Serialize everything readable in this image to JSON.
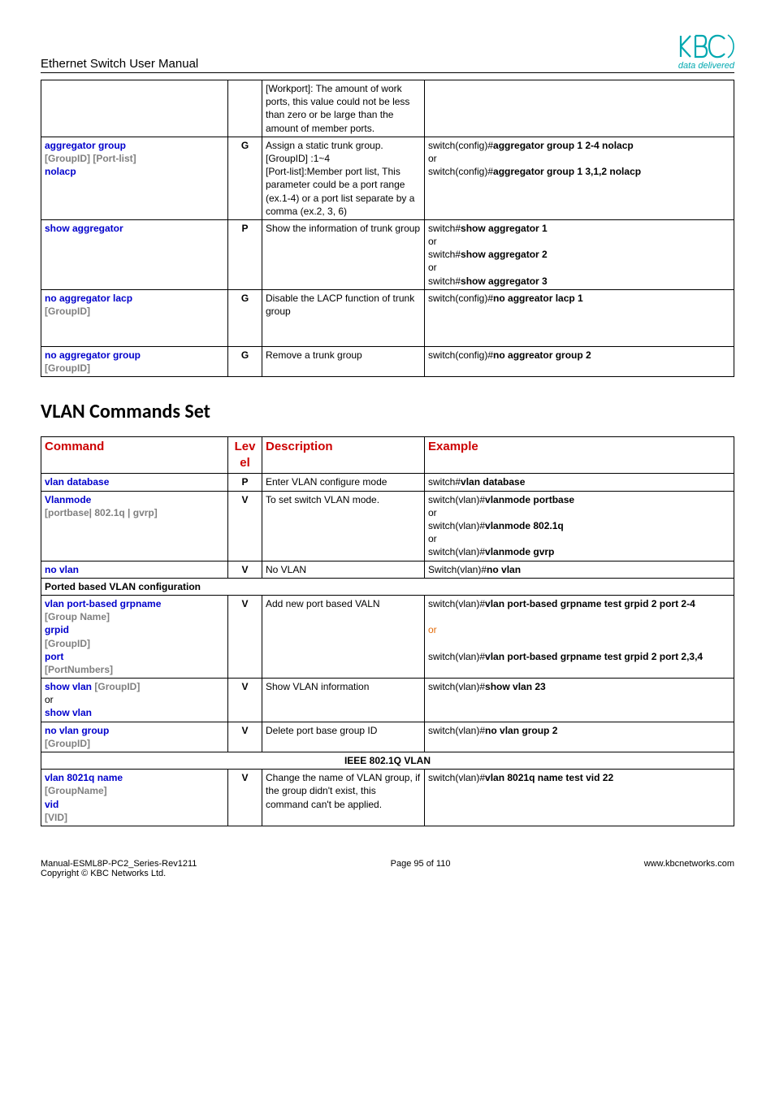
{
  "header": {
    "title": "Ethernet Switch User Manual",
    "logo_tag": "data delivered"
  },
  "table1": {
    "rows": [
      {
        "cmd_parts": [],
        "level": "",
        "desc": "[Workport]: The amount of work ports, this value could not be less than zero or be large than the amount of member ports.",
        "example_parts": []
      },
      {
        "cmd_parts": [
          {
            "text": "aggregator group",
            "cls": "blue bold"
          },
          {
            "text": "[GroupID] [Port-list]",
            "cls": "gray bold"
          },
          {
            "text": "nolacp",
            "cls": "blue bold"
          }
        ],
        "level": "G",
        "desc": "Assign a static trunk group.\n[GroupID] :1~4\n[Port-list]:Member port list, This parameter could be a port range (ex.1-4) or a port list separate by a comma (ex.2, 3, 6)",
        "example_parts": [
          {
            "pre": "switch(config)#",
            "bold": "aggregator group 1 2-4 nolacp"
          },
          {
            "pre": "or",
            "bold": ""
          },
          {
            "pre": "switch(config)#",
            "bold": "aggregator group 1 3,1,2 nolacp"
          }
        ]
      },
      {
        "cmd_parts": [
          {
            "text": "show aggregator",
            "cls": "blue bold"
          }
        ],
        "level": "P",
        "desc": "Show the information of trunk group",
        "example_parts": [
          {
            "pre": "switch#",
            "bold": "show aggregator 1"
          },
          {
            "pre": "or",
            "bold": ""
          },
          {
            "pre": "switch#",
            "bold": "show aggregator 2"
          },
          {
            "pre": "or",
            "bold": ""
          },
          {
            "pre": "switch#",
            "bold": "show aggregator 3"
          }
        ]
      },
      {
        "cmd_parts": [
          {
            "text": "no aggregator lacp",
            "cls": "blue bold"
          },
          {
            "text": "[GroupID]",
            "cls": "gray bold"
          }
        ],
        "level": "G",
        "desc": "Disable the LACP function of trunk group",
        "example_parts": [
          {
            "pre": "switch(config)#",
            "bold": "no aggreator lacp 1"
          }
        ],
        "min_lines": 4
      },
      {
        "cmd_parts": [
          {
            "text": "no aggregator group",
            "cls": "blue bold"
          },
          {
            "text": "[GroupID]",
            "cls": "gray bold"
          }
        ],
        "level": "G",
        "desc": "Remove a trunk group",
        "example_parts": [
          {
            "pre": "switch(config)#",
            "bold": "no aggreator group 2"
          }
        ],
        "min_lines": 2
      }
    ]
  },
  "section_heading": "VLAN Commands Set",
  "table2": {
    "headers": {
      "cmd": "Command",
      "lvl": "Level",
      "desc": "Description",
      "ex": "Example"
    },
    "rows": [
      {
        "type": "row",
        "cmd_parts": [
          {
            "text": "vlan database",
            "cls": "blue bold"
          }
        ],
        "level": "P",
        "desc": "Enter VLAN configure mode",
        "example_parts": [
          {
            "pre": "switch#",
            "bold": "vlan database"
          }
        ]
      },
      {
        "type": "row",
        "cmd_parts": [
          {
            "text": "Vlanmode",
            "cls": "blue bold"
          },
          {
            "text": "[portbase| 802.1q | gvrp]",
            "cls": "gray bold"
          }
        ],
        "level": "V",
        "desc": "To set switch VLAN mode.",
        "example_parts": [
          {
            "pre": "switch(vlan)#",
            "bold": "vlanmode portbase"
          },
          {
            "pre": "or",
            "bold": ""
          },
          {
            "pre": "switch(vlan)#",
            "bold": "vlanmode 802.1q"
          },
          {
            "pre": "or",
            "bold": ""
          },
          {
            "pre": "switch(vlan)#",
            "bold": "vlanmode gvrp"
          }
        ]
      },
      {
        "type": "row",
        "cmd_parts": [
          {
            "text": "no vlan",
            "cls": "blue bold"
          }
        ],
        "level": "V",
        "desc": "No VLAN",
        "example_parts": [
          {
            "pre": "Switch(vlan)#",
            "bold": "no vlan"
          }
        ]
      },
      {
        "type": "subheader",
        "text": "Ported based VLAN configuration",
        "align": "left"
      },
      {
        "type": "row",
        "cmd_parts": [
          {
            "text": "vlan port-based grpname",
            "cls": "blue bold"
          },
          {
            "text": "[Group Name]",
            "cls": "gray bold"
          },
          {
            "text": "grpid",
            "cls": "blue bold"
          },
          {
            "text": "[GroupID]",
            "cls": "gray bold"
          },
          {
            "text": "port",
            "cls": "blue bold"
          },
          {
            "text": "[PortNumbers]",
            "cls": "gray bold"
          }
        ],
        "level": "V",
        "desc": "Add new port based VALN",
        "example_parts": [
          {
            "pre": "switch(vlan)#",
            "bold": "vlan port-based grpname test grpid 2 port 2-4"
          },
          {
            "pre_cls": "orange",
            "pre": "or",
            "bold": ""
          },
          {
            "pre": "switch(vlan)#",
            "bold": "vlan port-based grpname test grpid 2 port 2,3,4"
          }
        ],
        "ex_spaced": true
      },
      {
        "type": "row",
        "cmd_parts": [
          {
            "text": "show vlan ",
            "cls": "blue bold",
            "inline_next": true
          },
          {
            "text": "[GroupID]",
            "cls": "gray bold",
            "inline": true
          },
          {
            "text": "or",
            "cls": ""
          },
          {
            "text": "show vlan",
            "cls": "blue bold"
          }
        ],
        "level": "V",
        "desc": "Show VLAN information",
        "example_parts": [
          {
            "pre": "switch(vlan)#",
            "bold": "show vlan 23"
          }
        ],
        "min_lines": 3
      },
      {
        "type": "row",
        "cmd_parts": [
          {
            "text": "no vlan group",
            "cls": "blue bold"
          },
          {
            "text": "[GroupID]",
            "cls": "gray bold"
          }
        ],
        "level": "V",
        "desc": "Delete port base group ID",
        "example_parts": [
          {
            "pre": "switch(vlan)#",
            "bold": "no vlan group 2"
          }
        ]
      },
      {
        "type": "subheader",
        "text": "IEEE 802.1Q VLAN",
        "align": "center"
      },
      {
        "type": "row",
        "cmd_parts": [
          {
            "text": "vlan 8021q name",
            "cls": "blue bold"
          },
          {
            "text": "[GroupName]",
            "cls": "gray bold"
          },
          {
            "text": "vid",
            "cls": "blue bold"
          },
          {
            "text": "[VID]",
            "cls": "gray bold"
          }
        ],
        "level": "V",
        "desc": "Change the name of VLAN group, if the group didn't exist, this command can't be applied.",
        "example_parts": [
          {
            "pre": "switch(vlan)#",
            "bold": "vlan 8021q name test vid 22"
          }
        ]
      }
    ]
  },
  "footer": {
    "left1": "Manual-ESML8P-PC2_Series-Rev1211",
    "left2": "Copyright © KBC Networks Ltd.",
    "center": "Page 95 of 110",
    "right": "www.kbcnetworks.com"
  }
}
